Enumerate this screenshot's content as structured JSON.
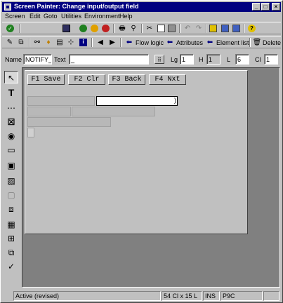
{
  "window": {
    "title": "Screen Painter:  Change input/output field",
    "minimize": "_",
    "maximize": "□",
    "close": "×"
  },
  "menu": [
    "Screen",
    "Edit",
    "Goto",
    "Utilities",
    "Environment",
    "Help"
  ],
  "toolbar2": {
    "flow_logic": "Flow logic",
    "attributes": "Attributes",
    "element_list": "Element list",
    "delete": "Delete"
  },
  "attr": {
    "name_label": "Name",
    "name_value": "NOTIFY_E",
    "text_label": "Text",
    "text_value": "_",
    "lg_label": "Lg",
    "lg_value": "1",
    "h_label": "H",
    "h_value": "1",
    "l_label": "L",
    "l_value": "6",
    "cl_label": "Cl",
    "cl_value": "1"
  },
  "canvas": {
    "fkeys": [
      "F1 Save",
      "F2 Clr",
      "F3 Back",
      "F4 Nxt"
    ],
    "io_suffix": ")"
  },
  "status": {
    "message": "Active (revised)",
    "position": "54 Cl x 15 L",
    "mode": "INS",
    "system": "P9C"
  },
  "palette": [
    "pointer-tool",
    "text-tool",
    "input-output-field-tool",
    "checkbox-tool",
    "radio-button-tool",
    "pushbutton-tool",
    "box-tool",
    "subscreen-tool",
    "tabstrip-tool",
    "custom-control-tool",
    "step-loop-tool",
    "table-control-tool",
    "table-control-wizard-tool",
    "status-icon-tool",
    "wizard-tool"
  ],
  "colors": {
    "titlebar": "#000080",
    "face": "#c0c0c0",
    "workspace": "#808080"
  }
}
